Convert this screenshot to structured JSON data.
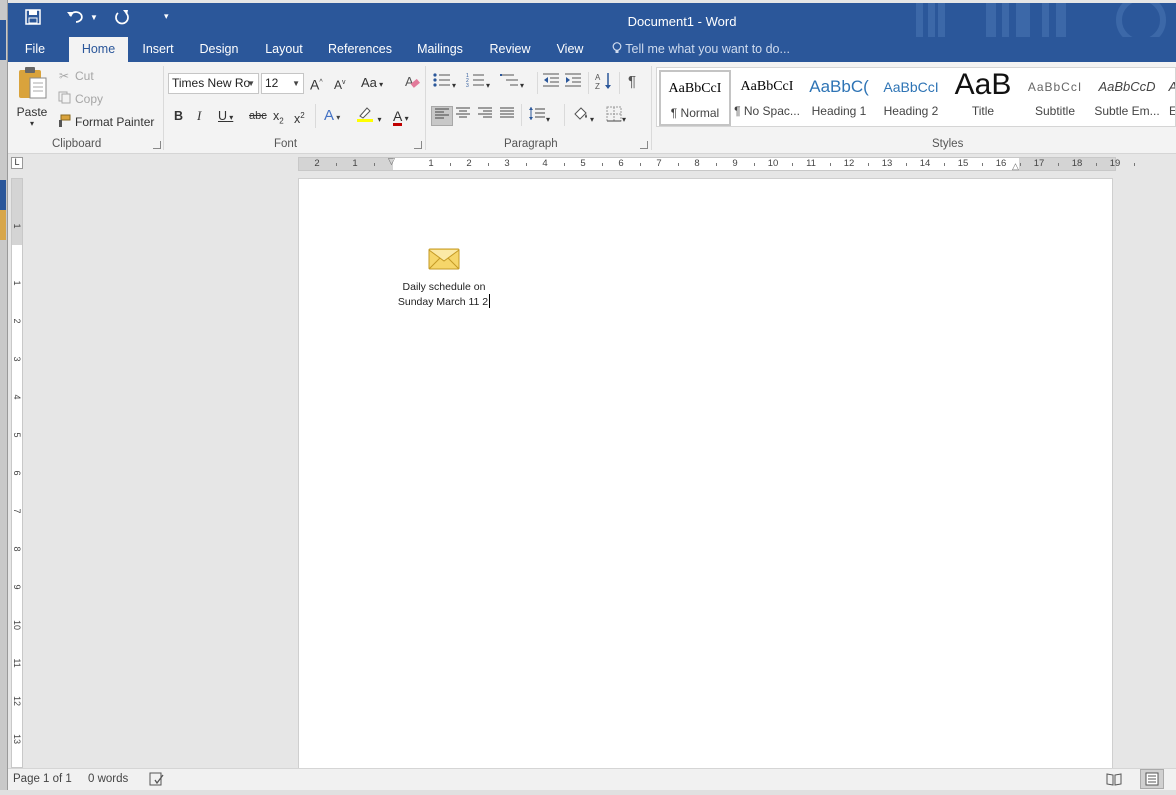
{
  "window": {
    "title": "Document1 - Word"
  },
  "quick_access": {
    "save_icon": "save-icon",
    "undo_icon": "undo-icon",
    "redo_icon": "redo-icon",
    "customize_icon": "customize-qat-icon"
  },
  "tabs": [
    {
      "label": "File"
    },
    {
      "label": "Home"
    },
    {
      "label": "Insert"
    },
    {
      "label": "Design"
    },
    {
      "label": "Layout"
    },
    {
      "label": "References"
    },
    {
      "label": "Mailings"
    },
    {
      "label": "Review"
    },
    {
      "label": "View"
    }
  ],
  "tellme": {
    "placeholder": "Tell me what you want to do..."
  },
  "clipboard": {
    "group": "Clipboard",
    "paste": "Paste",
    "cut": "Cut",
    "copy": "Copy",
    "format_painter": "Format Painter"
  },
  "font": {
    "group": "Font",
    "font_name": "Times New Ro",
    "font_size": "12",
    "grow": "A",
    "shrink": "A",
    "change_case": "Aa",
    "bold": "B",
    "italic": "I",
    "underline": "U",
    "strike": "abc",
    "subscript": "x",
    "sub_mark": "2",
    "superscript": "x",
    "sup_mark": "2",
    "text_effects": "A",
    "font_color": "A"
  },
  "paragraph": {
    "group": "Paragraph",
    "pilcrow": "¶"
  },
  "styles": {
    "group": "Styles",
    "items": [
      {
        "sample": "AaBbCcI",
        "name": "¶ Normal"
      },
      {
        "sample": "AaBbCcI",
        "name": "¶ No Spac..."
      },
      {
        "sample": "AaBbC(",
        "name": "Heading 1"
      },
      {
        "sample": "AaBbCcI",
        "name": "Heading 2"
      },
      {
        "sample": "AaB",
        "name": "Title"
      },
      {
        "sample": "AaBbCcI",
        "name": "Subtitle"
      },
      {
        "sample": "AaBbCcD",
        "name": "Subtle Em..."
      },
      {
        "sample": "A",
        "name": "E"
      }
    ]
  },
  "ruler": {
    "tab_selector": "L",
    "h_numbers": [
      "2",
      "1",
      "1",
      "2",
      "3",
      "4",
      "5",
      "6",
      "7",
      "8",
      "9",
      "10",
      "11",
      "12",
      "13",
      "14",
      "15",
      "16",
      "17",
      "18",
      "19"
    ],
    "v_numbers": [
      "1",
      "1",
      "2",
      "3",
      "4",
      "5",
      "6",
      "7",
      "8",
      "9",
      "10",
      "11",
      "12",
      "13"
    ]
  },
  "document": {
    "attachment_icon": "envelope-icon",
    "attachment_line1": "Daily schedule on",
    "attachment_line2": "Sunday March 11  2"
  },
  "status": {
    "page": "Page 1 of 1",
    "words": "0 words"
  }
}
